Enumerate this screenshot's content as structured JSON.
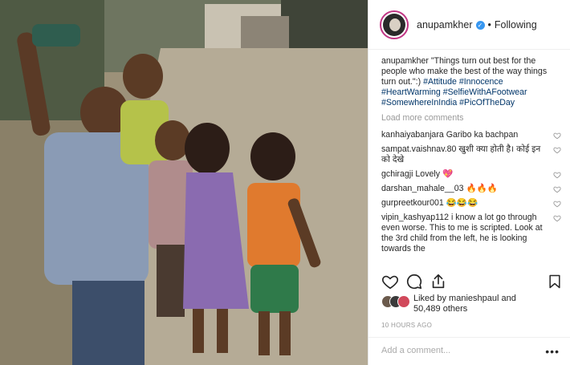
{
  "post": {
    "username": "anupamkher",
    "verified_icon": "verified-badge-icon",
    "separator": "•",
    "follow_status": "Following"
  },
  "caption": {
    "username": "anupamkher",
    "text": "\"Things turn out best for the people who make the best of the way things turn out.\":)",
    "hashtags": "#Attitude #Innocence #HeartWarming #SelfieWithAFootwear #SomewhereInIndia #PicOfTheDay"
  },
  "load_more": "Load more comments",
  "comments": [
    {
      "username": "kanhaiyabanjara",
      "text": "Garibo ka bachpan"
    },
    {
      "username": "sampat.vaishnav.80",
      "text": "खुशी क्या होती है। कोई इन को देखे"
    },
    {
      "username": "gchiragji",
      "text": "Lovely 💖"
    },
    {
      "username": "darshan_mahale__03",
      "text": "🔥🔥🔥"
    },
    {
      "username": "gurpreetkour001",
      "text": "😂😂😂"
    },
    {
      "username": "vipin_kashyap112",
      "text": "i know a lot go through even worse. This to me is scripted. Look at the 3rd child from the left, he is looking towards the"
    }
  ],
  "likes": {
    "prefix": "Liked by",
    "user": "manieshpaul",
    "connector": "and",
    "others": "50,489 others"
  },
  "timestamp": "10 HOURS AGO",
  "add_comment": {
    "placeholder": "Add a comment..."
  },
  "more_options": "•••",
  "icons": {
    "like": "heart-icon",
    "comment": "comment-icon",
    "share": "share-icon",
    "save": "bookmark-icon"
  },
  "colors": {
    "link": "#003569",
    "muted": "#999999",
    "verified": "#3897f0"
  }
}
